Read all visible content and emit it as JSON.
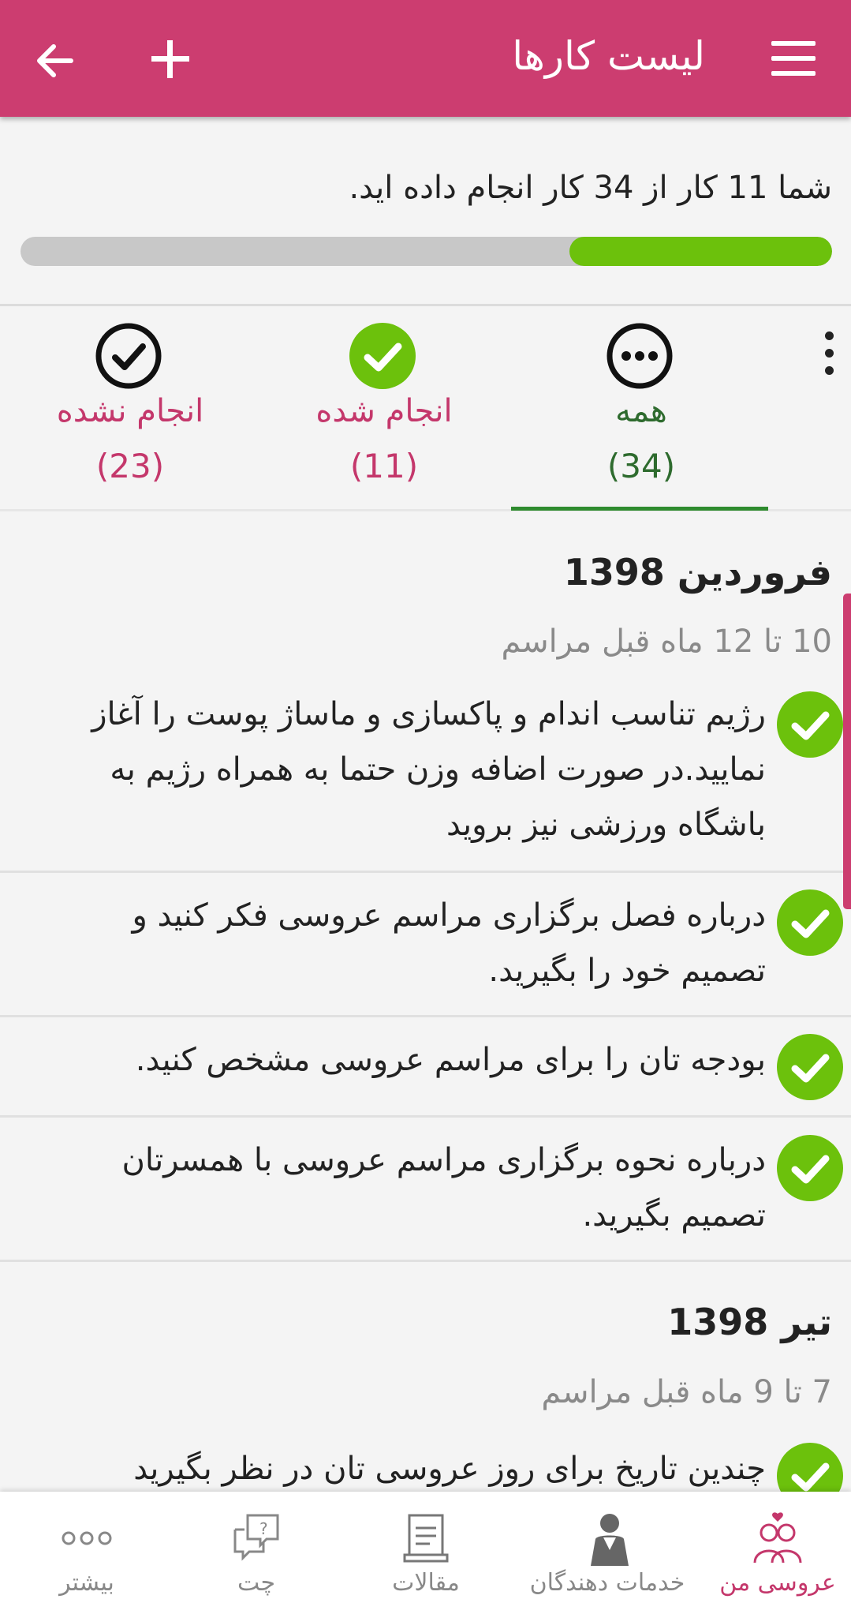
{
  "appbar": {
    "title": "لیست کارها"
  },
  "progress": {
    "text": "شما 11 کار از 34 کار انجام داده اید.",
    "done": 11,
    "total": 34,
    "fill_color": "#6cc10c"
  },
  "tabs": [
    {
      "id": "all",
      "label": "همه",
      "count": "(34)",
      "icon": "more-circle-icon",
      "selected": true
    },
    {
      "id": "done",
      "label": "انجام شده",
      "count": "(11)",
      "icon": "check-filled-icon",
      "selected": false
    },
    {
      "id": "not_done",
      "label": "انجام نشده",
      "count": "(23)",
      "icon": "check-outline-icon",
      "selected": false
    }
  ],
  "sections": [
    {
      "title": "فروردین 1398",
      "subtitle": "10 تا 12 ماه قبل مراسم",
      "tasks": [
        {
          "text": "رژیم تناسب اندام و پاکسازی و ماساژ پوست را آغاز نمایید.در صورت اضافه وزن حتما به همراه رژیم به باشگاه ورزشی نیز بروید",
          "done": true
        },
        {
          "text": "درباره فصل برگزاری مراسم عروسی فکر کنید و تصمیم خود را بگیرید.",
          "done": true
        },
        {
          "text": "بودجه تان را برای مراسم عروسی مشخص کنید.",
          "done": true
        },
        {
          "text": "درباره نحوه برگزاری مراسم عروسی با همسرتان تصمیم بگیرید.",
          "done": true
        }
      ]
    },
    {
      "title": "تیر 1398",
      "subtitle": "7 تا 9 ماه قبل مراسم",
      "tasks": [
        {
          "text": "چندین تاریخ برای روز عروسی تان در نظر بگیرید",
          "done": true
        }
      ]
    }
  ],
  "bottom_nav": [
    {
      "label": "عروسی من",
      "icon": "couple-icon",
      "active": true
    },
    {
      "label": "خدمات دهندگان",
      "icon": "vendor-person-icon",
      "active": false
    },
    {
      "label": "مقالات",
      "icon": "articles-icon",
      "active": false
    },
    {
      "label": "چت",
      "icon": "chat-question-icon",
      "active": false
    },
    {
      "label": "بیشتر",
      "icon": "more-dots-icon",
      "active": false
    }
  ],
  "colors": {
    "primary": "#cc3d70",
    "accent_green": "#6cc10c",
    "tab_selected": "#2e8b2e"
  }
}
